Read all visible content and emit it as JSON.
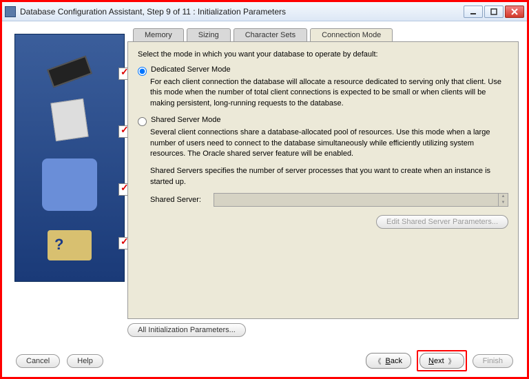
{
  "window": {
    "title": "Database Configuration Assistant, Step 9 of 11 : Initialization Parameters"
  },
  "tabs": {
    "memory": "Memory",
    "sizing": "Sizing",
    "charsets": "Character Sets",
    "connmode": "Connection Mode"
  },
  "panel": {
    "intro": "Select the mode in which you want your database to operate by default:",
    "dedicated": {
      "label": "Dedicated Server Mode",
      "desc": "For each client connection the database will allocate a resource dedicated to serving only that client.  Use this mode when the number of total client connections is expected to be small or when clients will be making persistent, long-running requests to the database."
    },
    "shared": {
      "label": "Shared Server Mode",
      "desc": "Several client connections share a database-allocated pool of resources.  Use this mode when a large number of users need to connect to the database simultaneously while efficiently utilizing system resources.  The Oracle shared server feature will be enabled.",
      "desc2": "Shared Servers specifies the number of server processes that you want to create when an instance is started up.",
      "field_label": "Shared Server:",
      "field_value": ""
    },
    "edit_shared_btn": "Edit Shared Server Parameters...",
    "all_params_btn": "All Initialization Parameters..."
  },
  "footer": {
    "cancel": "Cancel",
    "help": "Help",
    "back": "Back",
    "next": "Next",
    "finish": "Finish"
  },
  "icons": {
    "minimize": "minimize",
    "maximize": "maximize",
    "close": "close"
  }
}
